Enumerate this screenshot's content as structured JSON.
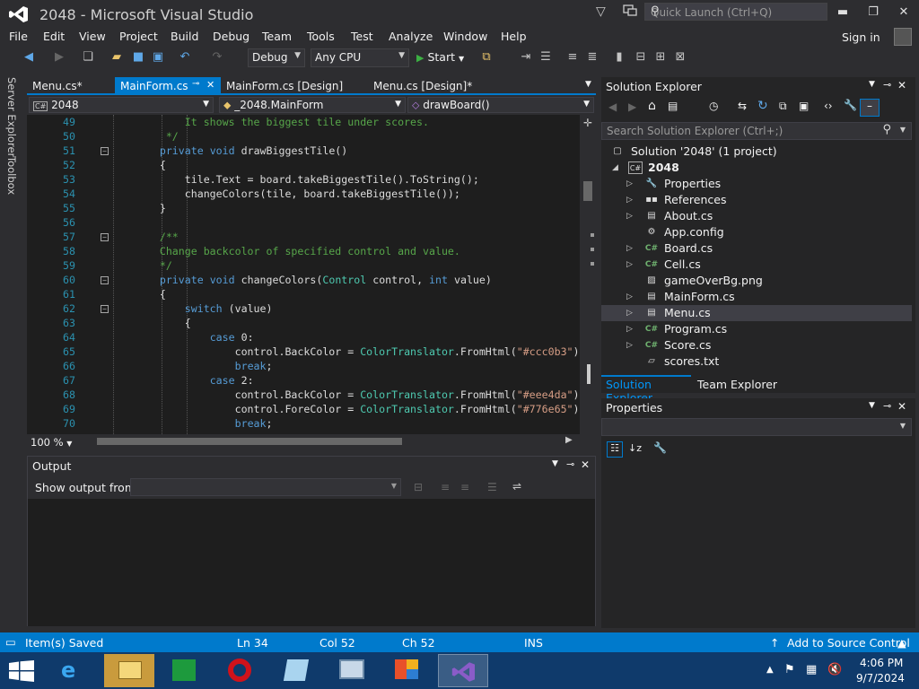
{
  "window": {
    "title": "2048 - Microsoft Visual Studio",
    "quick_launch_placeholder": "Quick Launch (Ctrl+Q)"
  },
  "menu": [
    "File",
    "Edit",
    "View",
    "Project",
    "Build",
    "Debug",
    "Team",
    "Tools",
    "Test",
    "Analyze",
    "Window",
    "Help"
  ],
  "signin_label": "Sign in",
  "toolbar": {
    "configuration": "Debug",
    "platform": "Any CPU",
    "start_label": "Start"
  },
  "side_tabs": [
    "Server Explorer",
    "Toolbox"
  ],
  "doc_tabs": [
    {
      "label": "Menu.cs*",
      "active": false
    },
    {
      "label": "MainForm.cs",
      "active": true
    },
    {
      "label": "MainForm.cs [Design]",
      "active": false
    },
    {
      "label": "Menu.cs [Design]*",
      "active": false
    }
  ],
  "navbar": {
    "project": "2048",
    "class": "_2048.MainForm",
    "member": "drawBoard()"
  },
  "editor": {
    "zoom": "100 %",
    "lines": [
      {
        "num": "49",
        "text": "            It shows the biggest tile under scores."
      },
      {
        "num": "50",
        "text": "         */"
      },
      {
        "num": "51",
        "text": "        private void drawBiggestTile()"
      },
      {
        "num": "52",
        "text": "        {"
      },
      {
        "num": "53",
        "text": "            tile.Text = board.takeBiggestTile().ToString();"
      },
      {
        "num": "54",
        "text": "            changeColors(tile, board.takeBiggestTile());"
      },
      {
        "num": "55",
        "text": "        }"
      },
      {
        "num": "56",
        "text": ""
      },
      {
        "num": "57",
        "text": "        /**"
      },
      {
        "num": "58",
        "text": "        Change backcolor of specified control and value."
      },
      {
        "num": "59",
        "text": "        */"
      },
      {
        "num": "60",
        "text": "        private void changeColors(Control control, int value)"
      },
      {
        "num": "61",
        "text": "        {"
      },
      {
        "num": "62",
        "text": "            switch (value)"
      },
      {
        "num": "63",
        "text": "            {"
      },
      {
        "num": "64",
        "text": "                case 0:"
      },
      {
        "num": "65",
        "text": "                    control.BackColor = ColorTranslator.FromHtml(\"#ccc0b3\");"
      },
      {
        "num": "66",
        "text": "                    break;"
      },
      {
        "num": "67",
        "text": "                case 2:"
      },
      {
        "num": "68",
        "text": "                    control.BackColor = ColorTranslator.FromHtml(\"#eee4da\");"
      },
      {
        "num": "69",
        "text": "                    control.ForeColor = ColorTranslator.FromHtml(\"#776e65\");"
      },
      {
        "num": "70",
        "text": "                    break;"
      }
    ]
  },
  "output": {
    "title": "Output",
    "show_output_from": "Show output from:",
    "source_value": ""
  },
  "solution_explorer": {
    "title": "Solution Explorer",
    "search_placeholder": "Search Solution Explorer (Ctrl+;)",
    "solution": "Solution '2048' (1 project)",
    "project": "2048",
    "items": [
      {
        "label": "Properties",
        "icon": "wrench-icon",
        "expandable": true
      },
      {
        "label": "References",
        "icon": "references-icon",
        "expandable": true
      },
      {
        "label": "About.cs",
        "icon": "form-icon",
        "expandable": true
      },
      {
        "label": "App.config",
        "icon": "config-icon",
        "expandable": false
      },
      {
        "label": "Board.cs",
        "icon": "csharp-icon",
        "expandable": true
      },
      {
        "label": "Cell.cs",
        "icon": "csharp-icon",
        "expandable": true
      },
      {
        "label": "gameOverBg.png",
        "icon": "image-icon",
        "expandable": false
      },
      {
        "label": "MainForm.cs",
        "icon": "form-icon",
        "expandable": true
      },
      {
        "label": "Menu.cs",
        "icon": "form-icon",
        "expandable": true,
        "selected": true
      },
      {
        "label": "Program.cs",
        "icon": "csharp-icon",
        "expandable": true
      },
      {
        "label": "Score.cs",
        "icon": "csharp-icon",
        "expandable": true
      },
      {
        "label": "scores.txt",
        "icon": "text-file-icon",
        "expandable": false
      }
    ],
    "bottom_tabs": [
      "Solution Explorer",
      "Team Explorer"
    ]
  },
  "properties": {
    "title": "Properties"
  },
  "statusbar": {
    "message": "Item(s) Saved",
    "line": "Ln 34",
    "col": "Col 52",
    "ch": "Ch 52",
    "mode": "INS",
    "source_control": "Add to Source Control"
  },
  "taskbar": {
    "time": "4:06 PM",
    "date": "9/7/2024"
  },
  "colors": {
    "accent": "#007acc",
    "keyword": "#569cd6",
    "type": "#4ec9b0",
    "comment": "#57a64a",
    "string": "#d69d85"
  }
}
